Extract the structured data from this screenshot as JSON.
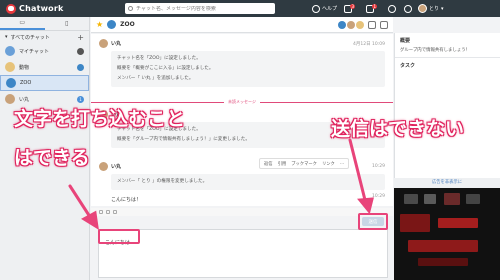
{
  "header": {
    "logo_text": "Chatwork",
    "search_placeholder": "チャット名、メッセージ内容を検索",
    "help_label": "ヘルプ",
    "badge_tasks": "3",
    "badge_contacts": "1",
    "user_name": "とり"
  },
  "sidebar": {
    "filter_label": "すべてのチャット",
    "rooms": [
      {
        "label": "マイチャット"
      },
      {
        "label": "動物",
        "badge": ""
      },
      {
        "label": "ZOO"
      },
      {
        "label": "い丸",
        "badge": "1"
      }
    ]
  },
  "chat": {
    "room_title": "ZOO",
    "unread_divider": "未読メッセージ",
    "messages": [
      {
        "author": "い丸",
        "time": "4月12日 10:09",
        "lines": [
          "チャット名を「ZOO」に設定しました。",
          "概要を「概要がここに入る」に設定しました。",
          "メンバー「 い丸 」を追加しました。"
        ]
      },
      {
        "author": "い丸",
        "time": "",
        "lines": [
          "チャット名を「ZOO」に設定しました。",
          "概要を「グループ内で情報共有しましょう！」に変更しました。"
        ]
      },
      {
        "author": "い丸",
        "time": "10:29",
        "lines": [
          "メンバー「 とり 」の権限を変更しました。"
        ]
      },
      {
        "author": "",
        "time": "10:29",
        "text": "こんにちは！"
      }
    ],
    "actions": [
      "返信",
      "引用",
      "ブックマーク",
      "リンク"
    ],
    "send_label": "送信",
    "composer_text": "こんにちは"
  },
  "right_panel": {
    "overview_title": "概要",
    "overview_text": "グループ内で情報共有しましょう！",
    "task_title": "タスク",
    "ad_label": "広告を非表示に"
  },
  "annotations": {
    "line1": "文字を打ち込むこと",
    "line2": "はできる",
    "right": "送信はできない"
  },
  "colors": {
    "header_bg": "#2f3a41",
    "accent": "#4a90d9",
    "annotation_pink": "#e8447a"
  }
}
